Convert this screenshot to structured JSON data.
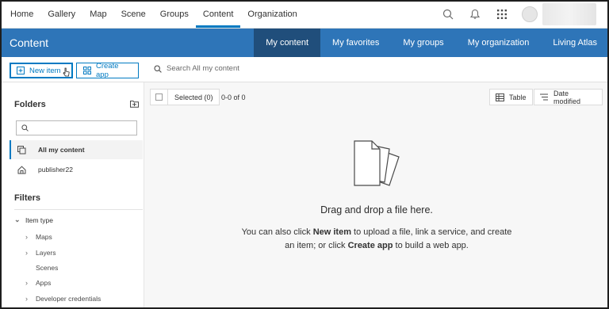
{
  "nav": {
    "links": [
      "Home",
      "Gallery",
      "Map",
      "Scene",
      "Groups",
      "Content",
      "Organization"
    ],
    "active": "Content",
    "icons": [
      "search-icon",
      "bell-icon",
      "app-launcher-icon"
    ]
  },
  "header": {
    "title": "Content",
    "tabs": [
      "My content",
      "My favorites",
      "My groups",
      "My organization",
      "Living Atlas"
    ],
    "active_tab": "My content"
  },
  "toolbar": {
    "new_item": "New item",
    "create_app": "Create app",
    "search_placeholder": "Search All my content"
  },
  "sidebar": {
    "folders_title": "Folders",
    "folder_search_placeholder": "",
    "folders": [
      "All my content",
      "publisher22"
    ],
    "filters_title": "Filters",
    "filter_group": "Item type",
    "filter_items": [
      "Maps",
      "Layers",
      "Scenes",
      "Apps",
      "Developer credentials"
    ]
  },
  "main": {
    "selected_label": "Selected (0)",
    "count": "0-0 of 0",
    "table_label": "Table",
    "sort_label": "Date modified",
    "drop_title": "Drag and drop a file here.",
    "drop_line1_a": "You can also click ",
    "drop_line1_b": "New item",
    "drop_line1_c": " to upload a file, link a service, and create",
    "drop_line2_a": "an item; or click ",
    "drop_line2_b": "Create app",
    "drop_line2_c": " to build a web app."
  },
  "colors": {
    "header_bg": "#2e75b8",
    "active_tab_bg": "#204e7b",
    "accent": "#007ac2"
  }
}
